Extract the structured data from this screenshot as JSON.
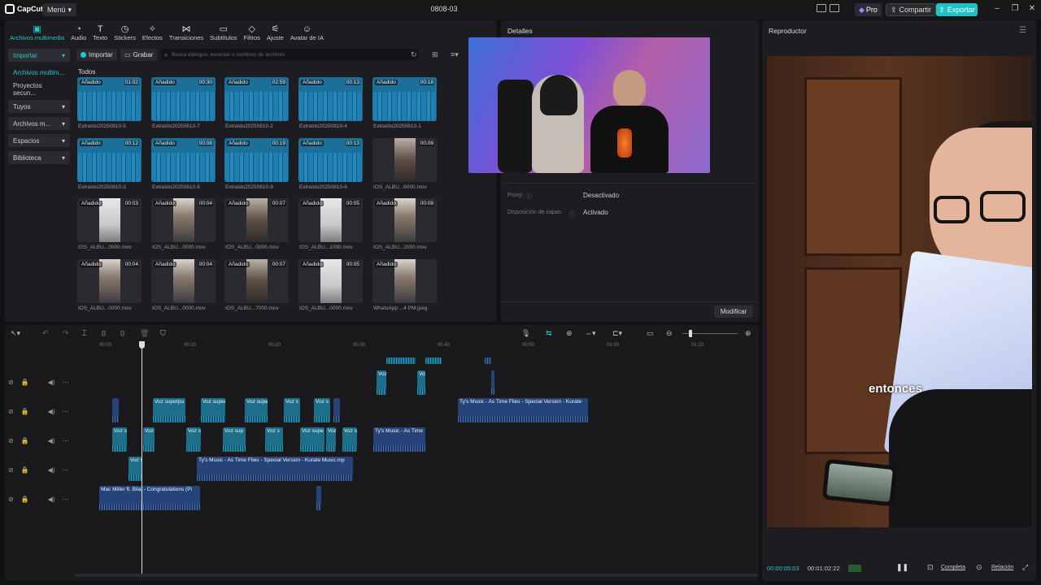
{
  "app": {
    "logo": "CapCut",
    "menu_label": "Menú",
    "project_title": "0808-03",
    "pro_label": "Pro",
    "share_label": "Compartir",
    "export_label": "Exportar",
    "accent_color": "#25c7cc"
  },
  "toolbar": {
    "items": [
      {
        "label": "Archivos multimedia",
        "icon": "media-icon"
      },
      {
        "label": "Audio",
        "icon": "audio-icon"
      },
      {
        "label": "Texto",
        "icon": "text-icon"
      },
      {
        "label": "Stickers",
        "icon": "sticker-icon"
      },
      {
        "label": "Efectos",
        "icon": "effects-icon"
      },
      {
        "label": "Transiciones",
        "icon": "transition-icon"
      },
      {
        "label": "Subtítulos",
        "icon": "subtitle-icon"
      },
      {
        "label": "Filtros",
        "icon": "filter-icon"
      },
      {
        "label": "Ajuste",
        "icon": "adjust-icon"
      },
      {
        "label": "Avatar de IA",
        "icon": "avatar-icon"
      }
    ]
  },
  "sidebar": {
    "items": [
      {
        "label": "Importar"
      },
      {
        "label": "Archivos multim..."
      },
      {
        "label": "Proyectos secun..."
      },
      {
        "label": "Tuyos"
      },
      {
        "label": "Archivos m..."
      },
      {
        "label": "Espacios"
      },
      {
        "label": "Biblioteca"
      }
    ]
  },
  "media": {
    "import_label": "Importar",
    "record_label": "Grabar",
    "search_placeholder": "Busca diálogos, escenas o nombres de archivos",
    "section_label": "Todos",
    "added_label": "Añadido",
    "items": [
      {
        "name": "Extraído20250810-5",
        "duration": "01:02",
        "kind": "audio"
      },
      {
        "name": "Extraído20250810-7",
        "duration": "00:30",
        "kind": "audio"
      },
      {
        "name": "Extraído20250810-2",
        "duration": "02:59",
        "kind": "audio"
      },
      {
        "name": "Extraído20250810-4",
        "duration": "00:13",
        "kind": "audio"
      },
      {
        "name": "Extraído20250810-1",
        "duration": "00:18",
        "kind": "audio"
      },
      {
        "name": "Extraído20250810-3",
        "duration": "00:12",
        "kind": "audio"
      },
      {
        "name": "Extraído20250810-8",
        "duration": "00:08",
        "kind": "audio"
      },
      {
        "name": "Extraído20250810-9",
        "duration": "00:19",
        "kind": "audio"
      },
      {
        "name": "Extraído20250810-6",
        "duration": "00:13",
        "kind": "audio"
      },
      {
        "name": "IOS_ALBU...6000.mov",
        "duration": "00:09",
        "kind": "video",
        "added": false
      },
      {
        "name": "IOS_ALBU...0000.mov",
        "duration": "00:03",
        "kind": "video"
      },
      {
        "name": "IOS_ALBU...0000.mov",
        "duration": "00:04",
        "kind": "video"
      },
      {
        "name": "IOS_ALBU...0000.mov",
        "duration": "00:07",
        "kind": "video"
      },
      {
        "name": "IOS_ALBU...1000.mov",
        "duration": "00:05",
        "kind": "video"
      },
      {
        "name": "IOS_ALBU...2000.mov",
        "duration": "00:08",
        "kind": "video"
      },
      {
        "name": "IOS_ALBU...0000.mov",
        "duration": "00:04",
        "kind": "video"
      },
      {
        "name": "IOS_ALBU...0000.mov",
        "duration": "00:04",
        "kind": "video"
      },
      {
        "name": "IOS_ALBU...7000.mov",
        "duration": "00:07",
        "kind": "video"
      },
      {
        "name": "IOS_ALBU...0000.mov",
        "duration": "00:05",
        "kind": "video"
      },
      {
        "name": "WhatsApp ...4 PM.jpeg",
        "duration": "",
        "kind": "image"
      }
    ]
  },
  "details": {
    "title": "Detalles",
    "rows": [
      {
        "label": "Proxy:",
        "value": "Desactivado"
      },
      {
        "label": "Disposición de capas",
        "value": "Activado"
      }
    ],
    "modify_label": "Modificar"
  },
  "player": {
    "title": "Reproductor",
    "caption": "entonces",
    "current_time": "00:00:05:03",
    "total_time": "00:01:02:22",
    "full_label": "Completa",
    "ratio_label": "Relación"
  },
  "timeline": {
    "ruler": [
      "00:00",
      "00:10",
      "00:20",
      "00:30",
      "00:40",
      "00:50",
      "01:00",
      "01:10"
    ],
    "clips": [
      {
        "label": "Voz superpu"
      },
      {
        "label": "Voz super"
      },
      {
        "label": "Voz supe"
      },
      {
        "label": "Voz s"
      },
      {
        "label": "Voz s"
      },
      {
        "label": "Ty's Music - As Time Flies - Special Version - Kurate"
      },
      {
        "label": "Voz s"
      },
      {
        "label": "Voz"
      },
      {
        "label": "Voz s"
      },
      {
        "label": "Voz sup"
      },
      {
        "label": "Voz s"
      },
      {
        "label": "Voz supe"
      },
      {
        "label": "Voz"
      },
      {
        "label": "Voz s"
      },
      {
        "label": "Ty's Music - As Time"
      },
      {
        "label": "Voz s"
      },
      {
        "label": "Ty's Music - As Time Flies - Special Version - Kurate Music.mp"
      },
      {
        "label": "Mac Miller ft. Bilal - Congratulations (Pi"
      },
      {
        "label": "Voz"
      },
      {
        "label": "Vo"
      }
    ]
  }
}
